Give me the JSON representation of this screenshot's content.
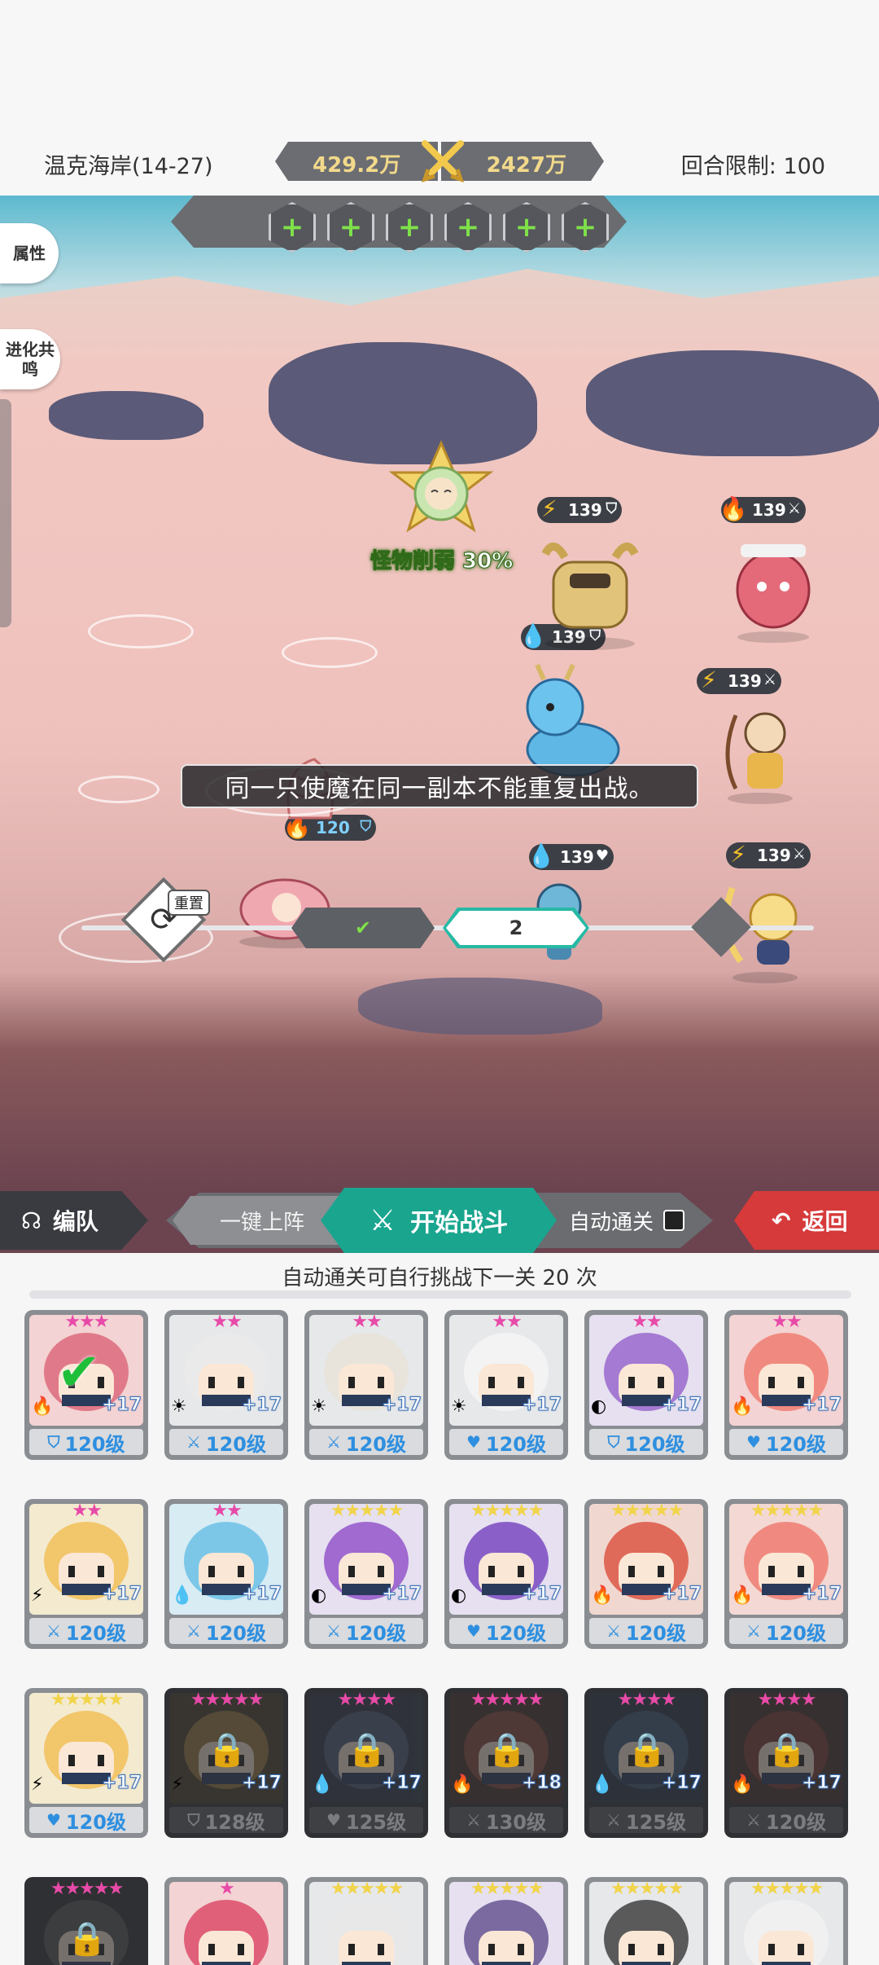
{
  "header": {
    "stage_name": "温克海岸(14-27)",
    "my_power": "429.2万",
    "enemy_power": "2427万",
    "turn_limit": "回合限制: 100"
  },
  "side_buttons": {
    "attributes": "属性",
    "evolution_resonance": "进化共鸣"
  },
  "slots": [
    "+",
    "+",
    "+",
    "+",
    "+",
    "+"
  ],
  "boss": {
    "debuff_label": "怪物削弱 30%"
  },
  "enemies": [
    {
      "element": "thunder",
      "level": "139",
      "class": "shield"
    },
    {
      "element": "fire",
      "level": "139",
      "class": "sword"
    },
    {
      "element": "water",
      "level": "139",
      "class": "shield"
    },
    {
      "element": "thunder",
      "level": "139",
      "class": "sword"
    },
    {
      "element": "water",
      "level": "139",
      "class": "heart"
    },
    {
      "element": "thunder",
      "level": "139",
      "class": "sword"
    }
  ],
  "ally": {
    "element": "fire",
    "level": "120",
    "class": "shield"
  },
  "ground_marker_number": "4",
  "notice": "同一只使魔在同一副本不能重复出战。",
  "progress": {
    "reset_label": "重置",
    "node_current": "2"
  },
  "actions": {
    "team_label": "编队",
    "deploy_label": "一键上阵",
    "start_label": "开始战斗",
    "auto_label": "自动通关",
    "back_label": "返回"
  },
  "roster": {
    "hint": "自动通关可自行挑战下一关 20 次",
    "cards": [
      {
        "stars": "★★★",
        "star_color": "#e84aa8",
        "plus": "+17",
        "level": "120级",
        "cls": "⛉",
        "elem": "🔥",
        "bg": "#f3d3d3",
        "hair": "#e07a8a",
        "locked": false,
        "selected": true
      },
      {
        "stars": "★★",
        "star_color": "#e84aa8",
        "plus": "+17",
        "level": "120级",
        "cls": "⚔",
        "elem": "☀",
        "bg": "#e6e8ea",
        "hair": "#eaeaea",
        "locked": false,
        "selected": false
      },
      {
        "stars": "★★",
        "star_color": "#e84aa8",
        "plus": "+17",
        "level": "120级",
        "cls": "⚔",
        "elem": "☀",
        "bg": "#e6e8ea",
        "hair": "#e8e4dc",
        "locked": false,
        "selected": false
      },
      {
        "stars": "★★",
        "star_color": "#e84aa8",
        "plus": "+17",
        "level": "120级",
        "cls": "♥",
        "elem": "☀",
        "bg": "#e6e8ea",
        "hair": "#f3f3f3",
        "locked": false,
        "selected": false
      },
      {
        "stars": "★★",
        "star_color": "#e84aa8",
        "plus": "+17",
        "level": "120级",
        "cls": "⛉",
        "elem": "◐",
        "bg": "#e6e0f0",
        "hair": "#a57ad2",
        "locked": false,
        "selected": false
      },
      {
        "stars": "★★",
        "star_color": "#e84aa8",
        "plus": "+17",
        "level": "120级",
        "cls": "♥",
        "elem": "🔥",
        "bg": "#f3d3d3",
        "hair": "#f08a80",
        "locked": false,
        "selected": false
      },
      {
        "stars": "★★",
        "star_color": "#e84aa8",
        "plus": "+17",
        "level": "120级",
        "cls": "⚔",
        "elem": "⚡",
        "bg": "#f3ead0",
        "hair": "#f2c66a",
        "locked": false,
        "selected": false
      },
      {
        "stars": "★★",
        "star_color": "#e84aa8",
        "plus": "+17",
        "level": "120级",
        "cls": "⚔",
        "elem": "💧",
        "bg": "#d8ecf4",
        "hair": "#7cc7e8",
        "locked": false,
        "selected": false
      },
      {
        "stars": "★★★★★",
        "star_color": "#f2d44a",
        "plus": "+17",
        "level": "120级",
        "cls": "⚔",
        "elem": "◐",
        "bg": "#e6e0f0",
        "hair": "#a06ad0",
        "locked": false,
        "selected": false
      },
      {
        "stars": "★★★★★",
        "star_color": "#f2d44a",
        "plus": "+17",
        "level": "120级",
        "cls": "♥",
        "elem": "◐",
        "bg": "#e6e0f0",
        "hair": "#8a60c8",
        "locked": false,
        "selected": false
      },
      {
        "stars": "★★★★★",
        "star_color": "#f2d44a",
        "plus": "+17",
        "level": "120级",
        "cls": "⚔",
        "elem": "🔥",
        "bg": "#f0d8d0",
        "hair": "#e06a5a",
        "locked": false,
        "selected": false
      },
      {
        "stars": "★★★★★",
        "star_color": "#f2d44a",
        "plus": "+17",
        "level": "120级",
        "cls": "⚔",
        "elem": "🔥",
        "bg": "#f3d8d3",
        "hair": "#f08a80",
        "locked": false,
        "selected": false
      },
      {
        "stars": "★★★★★",
        "star_color": "#f2d44a",
        "plus": "+17",
        "level": "120级",
        "cls": "♥",
        "elem": "⚡",
        "bg": "#f3ead0",
        "hair": "#f2c66a",
        "locked": false,
        "selected": false
      },
      {
        "stars": "★★★★★",
        "star_color": "#e84aa8",
        "plus": "+17",
        "level": "128级",
        "cls": "⛉",
        "elem": "⚡",
        "bg": "#4a4030",
        "hair": "#9a7a40",
        "locked": true,
        "selected": false
      },
      {
        "stars": "★★★★",
        "star_color": "#e84aa8",
        "plus": "+17",
        "level": "125级",
        "cls": "♥",
        "elem": "💧",
        "bg": "#303848",
        "hair": "#50607a",
        "locked": true,
        "selected": false
      },
      {
        "stars": "★★★★★",
        "star_color": "#e84aa8",
        "plus": "+18",
        "level": "130级",
        "cls": "⚔",
        "elem": "🔥",
        "bg": "#48302c",
        "hair": "#8a4a40",
        "locked": true,
        "selected": false
      },
      {
        "stars": "★★★★",
        "star_color": "#e84aa8",
        "plus": "+17",
        "level": "125级",
        "cls": "⚔",
        "elem": "💧",
        "bg": "#2c3848",
        "hair": "#405878",
        "locked": true,
        "selected": false
      },
      {
        "stars": "★★★★",
        "star_color": "#e84aa8",
        "plus": "+17",
        "level": "120级",
        "cls": "⚔",
        "elem": "🔥",
        "bg": "#48302c",
        "hair": "#7a3a34",
        "locked": true,
        "selected": false
      },
      {
        "stars": "★★★★★",
        "star_color": "#e84aa8",
        "plus": "",
        "level": "",
        "cls": "",
        "elem": "",
        "bg": "#2f3033",
        "hair": "#555",
        "locked": true,
        "selected": false
      },
      {
        "stars": "★",
        "star_color": "#e84aa8",
        "plus": "",
        "level": "",
        "cls": "",
        "elem": "",
        "bg": "#f3d3d3",
        "hair": "#e0607a",
        "locked": false,
        "selected": false
      },
      {
        "stars": "★★★★★",
        "star_color": "#f2d44a",
        "plus": "",
        "level": "",
        "cls": "",
        "elem": "",
        "bg": "#e6e8ea",
        "hair": "#e8e8e8",
        "locked": false,
        "selected": false
      },
      {
        "stars": "★★★★★",
        "star_color": "#f2d44a",
        "plus": "",
        "level": "",
        "cls": "",
        "elem": "",
        "bg": "#e6e0f0",
        "hair": "#7a6aa0",
        "locked": false,
        "selected": false
      },
      {
        "stars": "★★★★★",
        "star_color": "#f2d44a",
        "plus": "",
        "level": "",
        "cls": "",
        "elem": "",
        "bg": "#e6e8ea",
        "hair": "#5a5a5a",
        "locked": false,
        "selected": false
      },
      {
        "stars": "★★★★★",
        "star_color": "#f2d44a",
        "plus": "",
        "level": "",
        "cls": "",
        "elem": "",
        "bg": "#e6e8ea",
        "hair": "#f0f0f0",
        "locked": false,
        "selected": false
      }
    ]
  },
  "colors": {
    "accent_teal": "#1aa58f",
    "back_red": "#d63a3a",
    "panel_gray": "#6a6c70"
  }
}
